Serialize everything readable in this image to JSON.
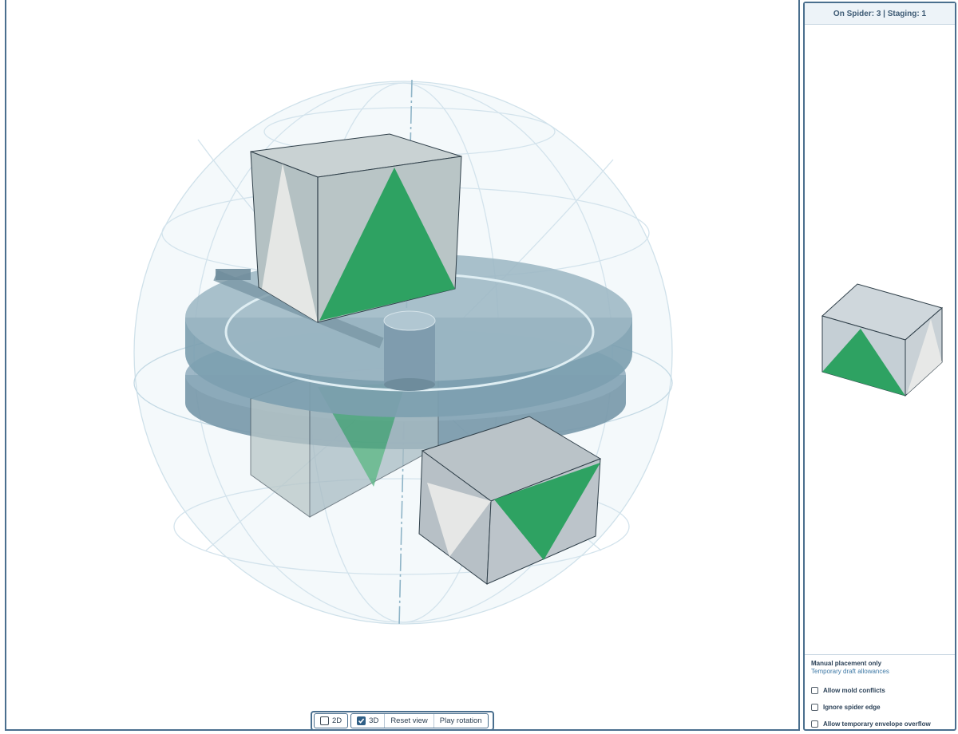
{
  "side_panel": {
    "header": "On Spider: 3 | Staging: 1",
    "options_title": "Manual placement only",
    "options_subtitle": "Temporary draft allowances",
    "options": [
      {
        "label": "Allow mold conflicts",
        "checked": false
      },
      {
        "label": "Ignore spider edge",
        "checked": false
      },
      {
        "label": "Allow temporary envelope overflow",
        "checked": false
      }
    ]
  },
  "toolbar": {
    "view_2d_label": "2D",
    "view_2d_checked": false,
    "view_3d_label": "3D",
    "view_3d_checked": true,
    "reset_label": "Reset view",
    "play_label": "Play rotation"
  },
  "colors": {
    "accent_green": "#2ea262",
    "frame_blue": "#4a6f8e",
    "disc_steel": "#7d9fb0",
    "envelope_line": "#cfe1ea"
  },
  "icons": [
    "checkbox-icon",
    "check-icon"
  ]
}
